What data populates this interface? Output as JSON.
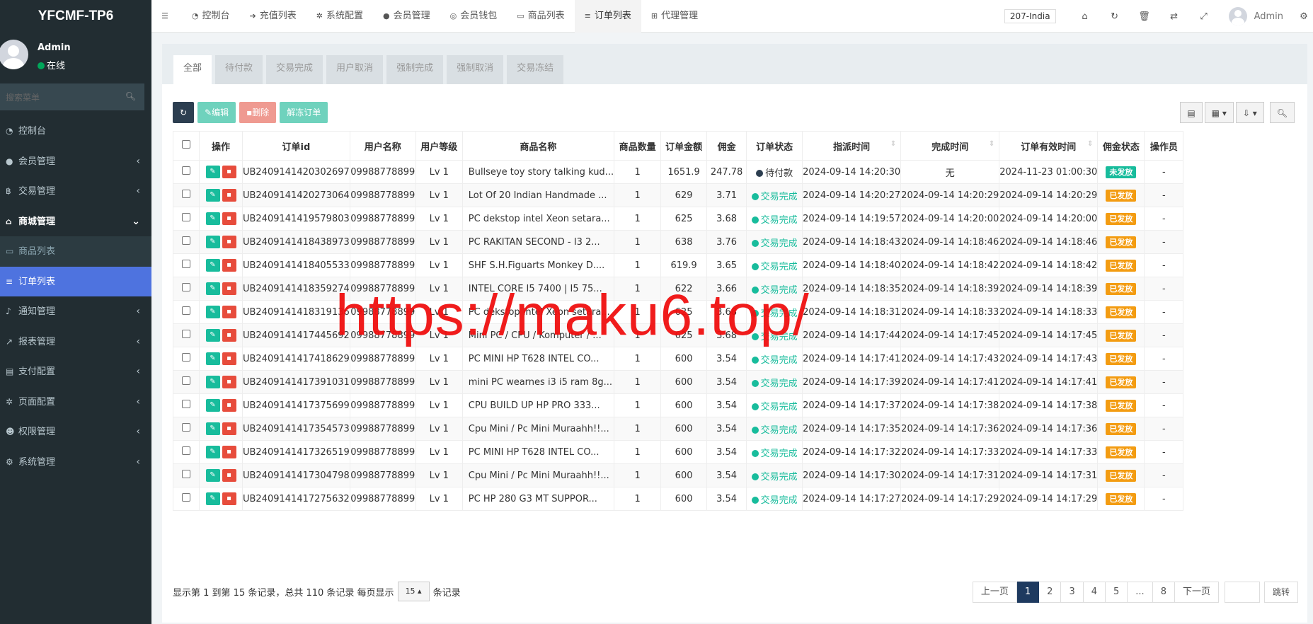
{
  "sidebar": {
    "logo": "YFCMF-TP6",
    "user": {
      "name": "Admin",
      "status": "在线"
    },
    "search_placeholder": "搜索菜单",
    "menu": [
      {
        "label": "控制台",
        "icon": "dashboard-icon"
      },
      {
        "label": "会员管理",
        "icon": "user-icon"
      },
      {
        "label": "交易管理",
        "icon": "bitcoin-icon"
      },
      {
        "label": "商城管理",
        "icon": "home-icon"
      },
      {
        "label": "商品列表",
        "icon": "monitor-icon"
      },
      {
        "label": "订单列表",
        "icon": "list-icon"
      },
      {
        "label": "通知管理",
        "icon": "bell-icon"
      },
      {
        "label": "报表管理",
        "icon": "chart-icon"
      },
      {
        "label": "支付配置",
        "icon": "card-icon"
      },
      {
        "label": "页面配置",
        "icon": "gear-icon"
      },
      {
        "label": "权限管理",
        "icon": "users-icon"
      },
      {
        "label": "系统管理",
        "icon": "cogs-icon"
      }
    ]
  },
  "topbar": {
    "tabs": [
      "控制台",
      "充值列表",
      "系统配置",
      "会员管理",
      "会员钱包",
      "商品列表",
      "订单列表",
      "代理管理"
    ],
    "lang": "207-India",
    "admin": "Admin"
  },
  "status_tabs": [
    "全部",
    "待付款",
    "交易完成",
    "用户取消",
    "强制完成",
    "强制取消",
    "交易冻结"
  ],
  "toolbar": {
    "edit": "编辑",
    "delete": "删除",
    "unfreeze": "解冻订单"
  },
  "table": {
    "headers": [
      "操作",
      "订单id",
      "用户名称",
      "用户等级",
      "商品名称",
      "商品数量",
      "订单金额",
      "佣金",
      "订单状态",
      "指派时间",
      "完成时间",
      "订单有效时间",
      "佣金状态",
      "操作员"
    ],
    "rows": [
      {
        "id": "UB2409141420302697",
        "user": "09988778899",
        "level": "Lv 1",
        "name": "Bullseye toy story talking kud...",
        "qty": "1",
        "amount": "1651.9",
        "comm": "247.78",
        "status": "待付款",
        "assigned": "2024-09-14 14:20:30",
        "done": "无",
        "valid": "2024-11-23 01:00:30",
        "cstatus": "未发放",
        "op": "-"
      },
      {
        "id": "UB2409141420273064",
        "user": "09988778899",
        "level": "Lv 1",
        "name": "Lot Of 20 Indian Handmade ...",
        "qty": "1",
        "amount": "629",
        "comm": "3.71",
        "status": "交易完成",
        "assigned": "2024-09-14 14:20:27",
        "done": "2024-09-14 14:20:29",
        "valid": "2024-09-14 14:20:29",
        "cstatus": "已发放",
        "op": "-"
      },
      {
        "id": "UB2409141419579803",
        "user": "09988778899",
        "level": "Lv 1",
        "name": "PC dekstop intel Xeon setara...",
        "qty": "1",
        "amount": "625",
        "comm": "3.68",
        "status": "交易完成",
        "assigned": "2024-09-14 14:19:57",
        "done": "2024-09-14 14:20:00",
        "valid": "2024-09-14 14:20:00",
        "cstatus": "已发放",
        "op": "-"
      },
      {
        "id": "UB2409141418438973",
        "user": "09988778899",
        "level": "Lv 1",
        "name": "PC RAKITAN SECOND - I3 2...",
        "qty": "1",
        "amount": "638",
        "comm": "3.76",
        "status": "交易完成",
        "assigned": "2024-09-14 14:18:43",
        "done": "2024-09-14 14:18:46",
        "valid": "2024-09-14 14:18:46",
        "cstatus": "已发放",
        "op": "-"
      },
      {
        "id": "UB2409141418405533",
        "user": "09988778899",
        "level": "Lv 1",
        "name": "SHF S.H.Figuarts Monkey D....",
        "qty": "1",
        "amount": "619.9",
        "comm": "3.65",
        "status": "交易完成",
        "assigned": "2024-09-14 14:18:40",
        "done": "2024-09-14 14:18:42",
        "valid": "2024-09-14 14:18:42",
        "cstatus": "已发放",
        "op": "-"
      },
      {
        "id": "UB2409141418359274",
        "user": "09988778899",
        "level": "Lv 1",
        "name": "INTEL CORE I5 7400 | I5 75...",
        "qty": "1",
        "amount": "622",
        "comm": "3.66",
        "status": "交易完成",
        "assigned": "2024-09-14 14:18:35",
        "done": "2024-09-14 14:18:39",
        "valid": "2024-09-14 14:18:39",
        "cstatus": "已发放",
        "op": "-"
      },
      {
        "id": "UB2409141418319136",
        "user": "09988778899",
        "level": "Lv 1",
        "name": "PC dekstop intel Xeon setara...",
        "qty": "1",
        "amount": "625",
        "comm": "3.68",
        "status": "交易完成",
        "assigned": "2024-09-14 14:18:31",
        "done": "2024-09-14 14:18:33",
        "valid": "2024-09-14 14:18:33",
        "cstatus": "已发放",
        "op": "-"
      },
      {
        "id": "UB2409141417445692",
        "user": "09988778899",
        "level": "Lv 1",
        "name": "Mini PC / CPU / Komputer / ...",
        "qty": "1",
        "amount": "625",
        "comm": "3.68",
        "status": "交易完成",
        "assigned": "2024-09-14 14:17:44",
        "done": "2024-09-14 14:17:45",
        "valid": "2024-09-14 14:17:45",
        "cstatus": "已发放",
        "op": "-"
      },
      {
        "id": "UB2409141417418629",
        "user": "09988778899",
        "level": "Lv 1",
        "name": "PC MINI HP T628 INTEL CO...",
        "qty": "1",
        "amount": "600",
        "comm": "3.54",
        "status": "交易完成",
        "assigned": "2024-09-14 14:17:41",
        "done": "2024-09-14 14:17:43",
        "valid": "2024-09-14 14:17:43",
        "cstatus": "已发放",
        "op": "-"
      },
      {
        "id": "UB2409141417391031",
        "user": "09988778899",
        "level": "Lv 1",
        "name": "mini PC wearnes i3 i5 ram 8g...",
        "qty": "1",
        "amount": "600",
        "comm": "3.54",
        "status": "交易完成",
        "assigned": "2024-09-14 14:17:39",
        "done": "2024-09-14 14:17:41",
        "valid": "2024-09-14 14:17:41",
        "cstatus": "已发放",
        "op": "-"
      },
      {
        "id": "UB2409141417375699",
        "user": "09988778899",
        "level": "Lv 1",
        "name": "CPU BUILD UP HP PRO 333...",
        "qty": "1",
        "amount": "600",
        "comm": "3.54",
        "status": "交易完成",
        "assigned": "2024-09-14 14:17:37",
        "done": "2024-09-14 14:17:38",
        "valid": "2024-09-14 14:17:38",
        "cstatus": "已发放",
        "op": "-"
      },
      {
        "id": "UB2409141417354573",
        "user": "09988778899",
        "level": "Lv 1",
        "name": "Cpu Mini / Pc Mini Muraahh!!...",
        "qty": "1",
        "amount": "600",
        "comm": "3.54",
        "status": "交易完成",
        "assigned": "2024-09-14 14:17:35",
        "done": "2024-09-14 14:17:36",
        "valid": "2024-09-14 14:17:36",
        "cstatus": "已发放",
        "op": "-"
      },
      {
        "id": "UB2409141417326519",
        "user": "09988778899",
        "level": "Lv 1",
        "name": "PC MINI HP T628 INTEL CO...",
        "qty": "1",
        "amount": "600",
        "comm": "3.54",
        "status": "交易完成",
        "assigned": "2024-09-14 14:17:32",
        "done": "2024-09-14 14:17:33",
        "valid": "2024-09-14 14:17:33",
        "cstatus": "已发放",
        "op": "-"
      },
      {
        "id": "UB2409141417304798",
        "user": "09988778899",
        "level": "Lv 1",
        "name": "Cpu Mini / Pc Mini Muraahh!!...",
        "qty": "1",
        "amount": "600",
        "comm": "3.54",
        "status": "交易完成",
        "assigned": "2024-09-14 14:17:30",
        "done": "2024-09-14 14:17:31",
        "valid": "2024-09-14 14:17:31",
        "cstatus": "已发放",
        "op": "-"
      },
      {
        "id": "UB2409141417275632",
        "user": "09988778899",
        "level": "Lv 1",
        "name": "PC HP 280 G3 MT SUPPOR...",
        "qty": "1",
        "amount": "600",
        "comm": "3.54",
        "status": "交易完成",
        "assigned": "2024-09-14 14:17:27",
        "done": "2024-09-14 14:17:29",
        "valid": "2024-09-14 14:17:29",
        "cstatus": "已发放",
        "op": "-"
      }
    ]
  },
  "footer": {
    "info_prefix": "显示第 1 到第 15 条记录，总共 110 条记录 每页显示",
    "page_size": "15",
    "info_suffix": "条记录",
    "pages": [
      "上一页",
      "1",
      "2",
      "3",
      "4",
      "5",
      "...",
      "8",
      "下一页"
    ],
    "jump": "跳转"
  },
  "watermark": "https://maku6.top/"
}
